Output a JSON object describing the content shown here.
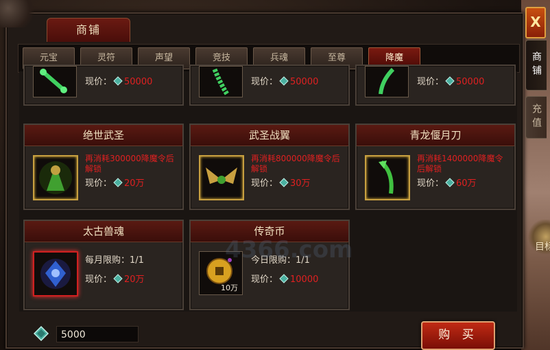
{
  "window": {
    "title": "商铺",
    "close_label": "X"
  },
  "side_tabs": [
    {
      "label": "商铺",
      "active": true
    },
    {
      "label": "充值",
      "active": false
    }
  ],
  "side_ornament": {
    "label": "目标"
  },
  "categories": [
    "元宝",
    "灵符",
    "声望",
    "竞技",
    "兵魂",
    "至尊",
    "降魔"
  ],
  "active_category": "降魔",
  "price_label": "现价：",
  "top_row_prices": [
    "50000",
    "50000",
    "50000"
  ],
  "items": [
    {
      "name": "绝世武圣",
      "unlock": "再消耗300000降魔令后解锁",
      "price": "20万",
      "icon": "green-dragon-warrior-icon"
    },
    {
      "name": "武圣战翼",
      "unlock": "再消耗800000降魔令后解锁",
      "price": "30万",
      "icon": "golden-wings-icon"
    },
    {
      "name": "青龙偃月刀",
      "unlock": "再消耗1400000降魔令后解锁",
      "price": "60万",
      "icon": "green-glaive-icon"
    },
    {
      "name": "太古兽魂",
      "limit": "每月限购：1/1",
      "price": "20万",
      "icon": "blue-beast-soul-icon"
    },
    {
      "name": "传奇币",
      "limit": "今日限购：1/1",
      "price": "10000",
      "icon": "gold-coin-icon",
      "qty": "10万"
    }
  ],
  "watermark": "4366.com",
  "balance": "5000",
  "buy_label": "购 买",
  "colors": {
    "accent_red": "#e02020",
    "gem": "#4ab0a0"
  }
}
